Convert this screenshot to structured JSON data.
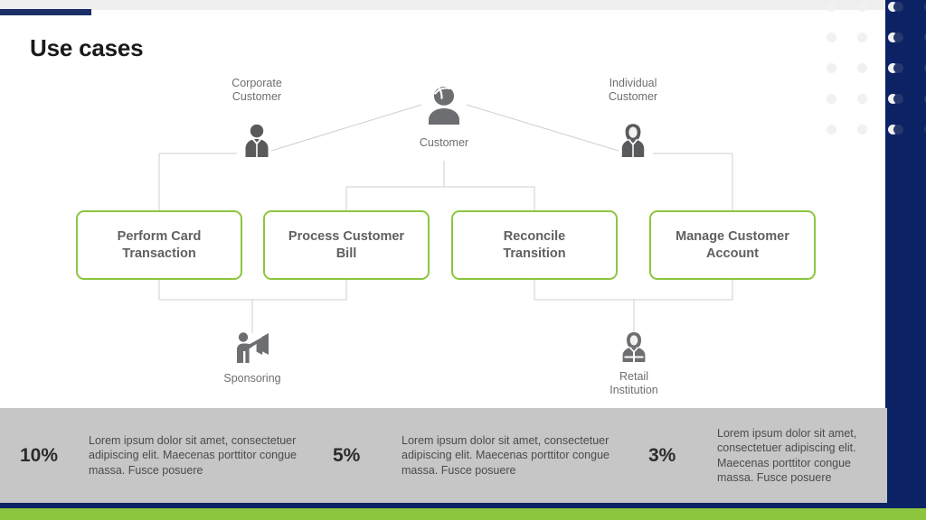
{
  "slide": {
    "title": "Use cases",
    "accent_navy": "#0b2265",
    "accent_green": "#8cc63f",
    "band_gray": "#c6c6c6"
  },
  "diagram": {
    "actors": [
      {
        "id": "customer",
        "label": "Customer",
        "icon": "person-icon"
      },
      {
        "id": "corporate",
        "label": "Corporate\nCustomer",
        "line1": "Corporate",
        "line2": "Customer",
        "icon": "businessman-icon"
      },
      {
        "id": "individual",
        "label": "Individual\nCustomer",
        "line1": "Individual",
        "line2": "Customer",
        "icon": "businesswoman-icon"
      },
      {
        "id": "sponsoring",
        "label": "Sponsoring",
        "icon": "megaphone-person-icon"
      },
      {
        "id": "retail",
        "label": "Retail\nInstitution",
        "line1": "Retail",
        "line2": "Institution",
        "icon": "bank-teller-icon"
      }
    ],
    "use_cases": [
      {
        "id": "perform-card-transaction",
        "label": "Perform Card\nTransaction",
        "line1": "Perform Card",
        "line2": "Transaction"
      },
      {
        "id": "process-customer-bill",
        "label": "Process Customer\nBill",
        "line1": "Process Customer",
        "line2": "Bill"
      },
      {
        "id": "reconcile-transition",
        "label": "Reconcile\nTransition",
        "line1": "Reconcile",
        "line2": "Transition"
      },
      {
        "id": "manage-customer-account",
        "label": "Manage Customer\nAccount",
        "line1": "Manage Customer",
        "line2": "Account"
      }
    ]
  },
  "stats": [
    {
      "percent": "10%",
      "description": "Lorem ipsum dolor sit amet, consectetuer adipiscing elit. Maecenas porttitor congue massa. Fusce posuere"
    },
    {
      "percent": "5%",
      "description": "Lorem ipsum dolor sit amet, consectetuer adipiscing elit. Maecenas porttitor congue massa. Fusce posuere"
    },
    {
      "percent": "3%",
      "description": "Lorem ipsum dolor sit amet, consectetuer adipiscing elit. Maecenas porttitor congue massa. Fusce posuere"
    }
  ]
}
